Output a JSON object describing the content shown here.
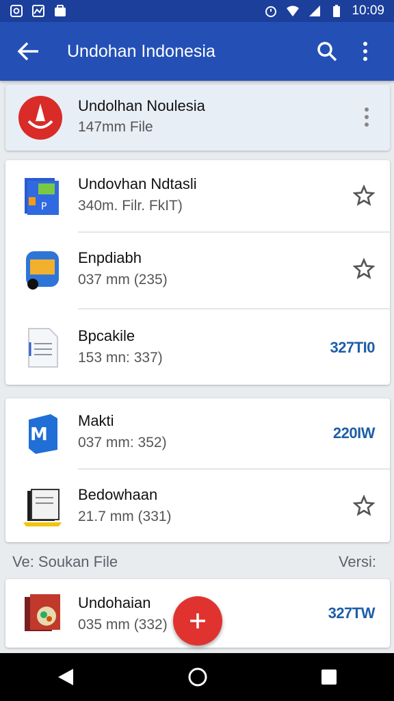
{
  "status_bar": {
    "time": "10:09"
  },
  "app_bar": {
    "title": "Undohan Indonesia"
  },
  "header_item": {
    "name": "Undolhan Noulesia",
    "meta": "147mm File"
  },
  "group1": [
    {
      "name": "Undovhan Ndtasli",
      "meta": "340m. Filr. FkIT)",
      "trailing": "star"
    },
    {
      "name": "Enpdiabh",
      "meta": "037 mm (235)",
      "trailing": "star"
    },
    {
      "name": "Bpcakile",
      "meta": "153 mn: 337)",
      "trailing_text": "327TI0"
    }
  ],
  "group2": [
    {
      "name": "Makti",
      "meta": "037 mm: 352)",
      "trailing_text": "220IW"
    },
    {
      "name": "Bedowhaan",
      "meta": "21.7 mm (331)",
      "trailing": "star"
    }
  ],
  "section": {
    "left": "Ve: Soukan File",
    "right": "Versi:"
  },
  "group3": [
    {
      "name": "Undohaian",
      "meta": "035 mm (332)",
      "trailing_text": "327TW"
    }
  ],
  "colors": {
    "appbar": "#2450b6",
    "statusbar": "#1c3f9c",
    "fab": "#e0332f",
    "accent_text": "#1d5ea8"
  }
}
